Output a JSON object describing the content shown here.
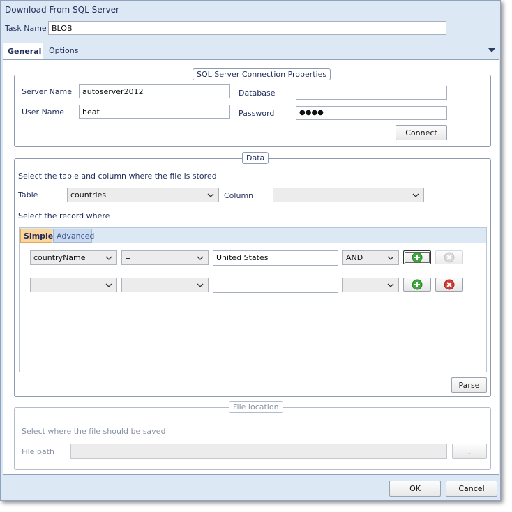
{
  "window": {
    "title": "Download From SQL Server"
  },
  "task": {
    "label": "Task Name",
    "value": "BLOB"
  },
  "tabs": [
    {
      "label": "General"
    },
    {
      "label": "Options"
    }
  ],
  "connection": {
    "caption": "SQL Server Connection Properties",
    "server_label": "Server Name",
    "server_value": "autoserver2012",
    "database_label": "Database",
    "database_value": "",
    "user_label": "User Name",
    "user_value": "heat",
    "password_label": "Password",
    "password_value": "●●●●",
    "connect_label": "Connect"
  },
  "data": {
    "caption": "Data",
    "instruction": "Select the table and column where the file is stored",
    "table_label": "Table",
    "table_value": "countries",
    "column_label": "Column",
    "column_value": "",
    "record_instruction": "Select the record where",
    "subtabs": [
      {
        "label": "Simple"
      },
      {
        "label": "Advanced"
      }
    ],
    "rows": [
      {
        "field": "countryName",
        "operator": "=",
        "value": "United States",
        "conjunction": "AND"
      },
      {
        "field": "",
        "operator": "",
        "value": "",
        "conjunction": ""
      }
    ],
    "parse_label": "Parse"
  },
  "file_location": {
    "caption": "File location",
    "instruction": "Select where the file should be saved",
    "path_label": "File path",
    "path_value": "",
    "browse_label": "..."
  },
  "footer": {
    "ok_label": "OK",
    "cancel_label": "Cancel"
  },
  "colors": {
    "accent": "#8fa3c0",
    "add_icon": "#3fa83a",
    "remove_icon": "#d23a35"
  }
}
